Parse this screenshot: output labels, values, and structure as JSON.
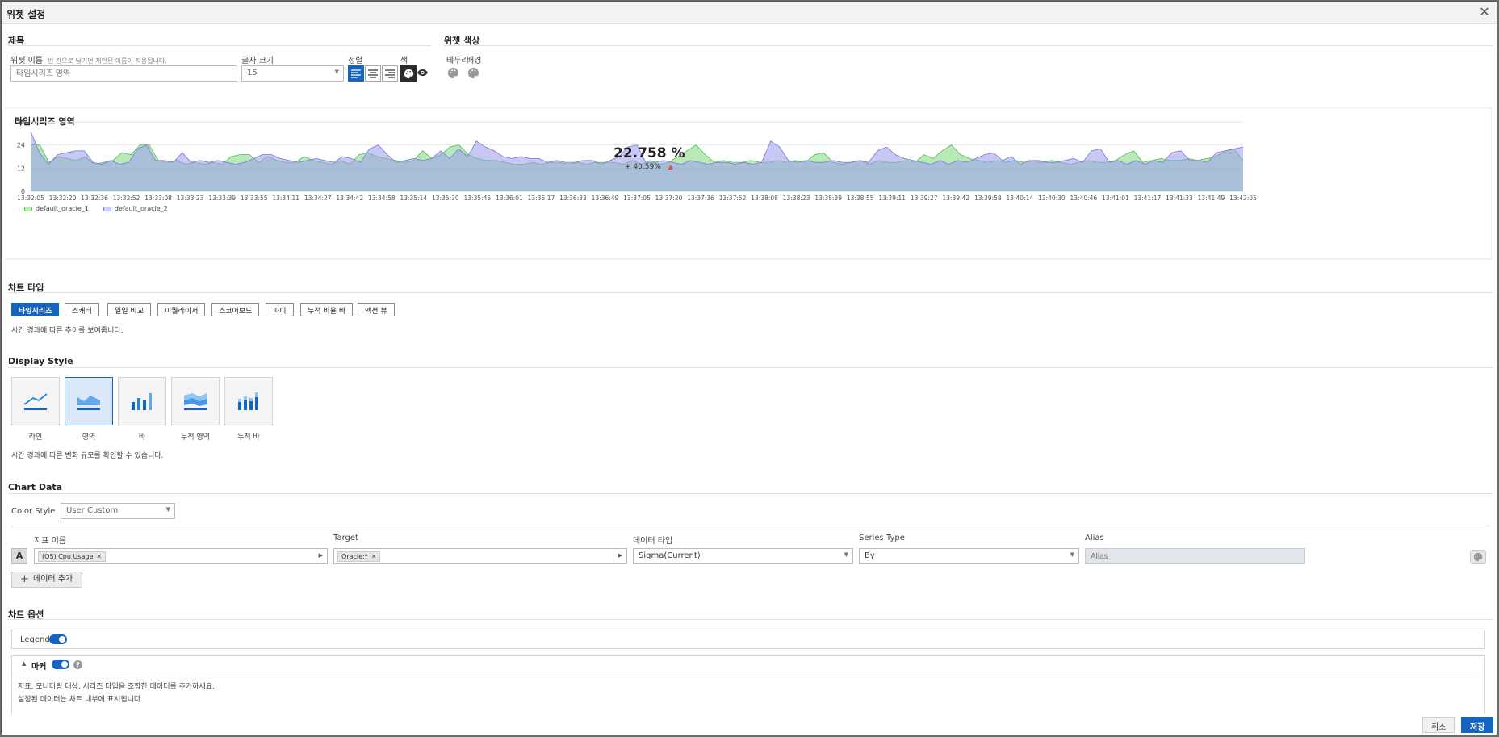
{
  "modal": {
    "title": "위젯 설정"
  },
  "title_section": {
    "heading": "제목",
    "widget_name_label": "위젯 이름",
    "widget_name_hint": "빈 칸으로 남기면 제안된 이름이 적용됩니다.",
    "widget_name_placeholder": "타임시리즈 영역",
    "font_size_label": "글자 크기",
    "font_size_value": "15",
    "align_label": "정렬",
    "color_label": "색"
  },
  "widget_color_section": {
    "heading": "위젯 색상",
    "border_label": "테두리",
    "background_label": "배경"
  },
  "preview": {
    "title": "타임시리즈 영역",
    "big_value": "22.758 %",
    "delta": "+ 40.59%",
    "legend": [
      {
        "name": "default_oracle_1",
        "color": "#7dd87d"
      },
      {
        "name": "default_oracle_2",
        "color": "#9a9af0"
      }
    ]
  },
  "chart_data": {
    "type": "area",
    "title": "타임시리즈 영역",
    "ylim": [
      0,
      36
    ],
    "yticks": [
      "0",
      "12",
      "24",
      "36"
    ],
    "xtick_labels": [
      "13:32:05",
      "13:32:20",
      "13:32:36",
      "13:32:52",
      "13:33:08",
      "13:33:23",
      "13:33:39",
      "13:33:55",
      "13:34:11",
      "13:34:27",
      "13:34:42",
      "13:34:58",
      "13:35:14",
      "13:35:30",
      "13:35:46",
      "13:36:01",
      "13:36:17",
      "13:36:33",
      "13:36:49",
      "13:37:05",
      "13:37:20",
      "13:37:36",
      "13:37:52",
      "13:38:08",
      "13:38:23",
      "13:38:39",
      "13:38:55",
      "13:39:11",
      "13:39:27",
      "13:39:42",
      "13:39:58",
      "13:40:14",
      "13:40:30",
      "13:40:46",
      "13:41:01",
      "13:41:17",
      "13:41:33",
      "13:41:49",
      "13:42:05"
    ],
    "grid": true,
    "legend_position": "bottom-left",
    "series": [
      {
        "name": "default_oracle_1",
        "color": "#7dd87d",
        "values": [
          24,
          24,
          15,
          18,
          17,
          16,
          18,
          14,
          15,
          16,
          20,
          19,
          24,
          24,
          16,
          15,
          16,
          14,
          15,
          14,
          15,
          14,
          18,
          19,
          19,
          15,
          18,
          16,
          15,
          15,
          18,
          16,
          15,
          14,
          16,
          14,
          19,
          20,
          18,
          17,
          16,
          15,
          16,
          21,
          17,
          19,
          23,
          24,
          19,
          17,
          16,
          16,
          15,
          14,
          14,
          15,
          14,
          15,
          15,
          14,
          15,
          14,
          15,
          15,
          15,
          14,
          16,
          14,
          16,
          14,
          15,
          18,
          21,
          24,
          19,
          15,
          16,
          15,
          15,
          16,
          15,
          15,
          16,
          15,
          16,
          15,
          19,
          20,
          15,
          14,
          15,
          16,
          14,
          16,
          15,
          15,
          16,
          15,
          19,
          17,
          21,
          24,
          19,
          17,
          16,
          15,
          16,
          15,
          16,
          15,
          16,
          15,
          16,
          15,
          14,
          15,
          16,
          15,
          15,
          16,
          19,
          21,
          15,
          16,
          17,
          16,
          16,
          17,
          16,
          17,
          18,
          21,
          22,
          16
        ]
      },
      {
        "name": "default_oracle_2",
        "color": "#9a9af0",
        "values": [
          31,
          20,
          14,
          19,
          20,
          21,
          21,
          15,
          14,
          16,
          14,
          15,
          22,
          24,
          16,
          16,
          15,
          20,
          15,
          16,
          15,
          16,
          15,
          14,
          15,
          17,
          19,
          19,
          17,
          16,
          15,
          16,
          17,
          16,
          15,
          18,
          17,
          15,
          22,
          24,
          19,
          15,
          16,
          17,
          16,
          17,
          21,
          17,
          22,
          18,
          26,
          23,
          21,
          18,
          17,
          18,
          17,
          17,
          15,
          16,
          15,
          15,
          16,
          16,
          14,
          16,
          18,
          23,
          24,
          15,
          15,
          16,
          15,
          14,
          16,
          15,
          14,
          15,
          15,
          14,
          15,
          14,
          15,
          26,
          23,
          16,
          15,
          16,
          15,
          15,
          16,
          15,
          15,
          16,
          15,
          21,
          23,
          19,
          17,
          16,
          15,
          14,
          16,
          14,
          16,
          15,
          17,
          19,
          20,
          16,
          18,
          14,
          16,
          16,
          15,
          15,
          16,
          17,
          15,
          21,
          22,
          15,
          16,
          14,
          16,
          14,
          16,
          15,
          20,
          21,
          16,
          16,
          15,
          20,
          21,
          22,
          23
        ]
      }
    ]
  },
  "chart_type": {
    "heading": "차트 타입",
    "buttons": [
      "타임시리즈",
      "스캐터",
      "일일 비교",
      "이퀄라이저",
      "스코어보드",
      "파이",
      "누적 비율 바",
      "액션 뷰"
    ],
    "active": "타임시리즈",
    "description": "시간 경과에 따른 추이를 보여줍니다."
  },
  "display_style": {
    "heading": "Display Style",
    "options": [
      "라인",
      "영역",
      "바",
      "누적 영역",
      "누적 바"
    ],
    "active": "영역",
    "description": "시간 경과에 따른 변화 규모를 확인할 수 있습니다."
  },
  "chart_data_section": {
    "heading": "Chart Data",
    "color_style_label": "Color Style",
    "color_style_value": "User Custom",
    "columns": {
      "metric": "지표 이름",
      "target": "Target",
      "data_type": "데이터 타입",
      "series_type": "Series Type",
      "alias": "Alias"
    },
    "row": {
      "letter": "A",
      "metric_tag": "(OS) Cpu Usage",
      "target_tag": "Oracle:*",
      "data_type": "Sigma(Current)",
      "series_type": "By",
      "alias_placeholder": "Alias"
    },
    "add_button": "데이터 추가"
  },
  "chart_options": {
    "heading": "차트 옵션",
    "legend_label": "Legend",
    "marker_label": "마커",
    "marker_desc_1": "지표, 모니터링 대상, 시리즈 타입을 조합한 데이터를 추가하세요.",
    "marker_desc_2": "설정된 데이터는 차트 내부에 표시됩니다."
  },
  "footer": {
    "cancel": "취소",
    "save": "저장"
  },
  "colors": {
    "accent": "#1565c0"
  }
}
